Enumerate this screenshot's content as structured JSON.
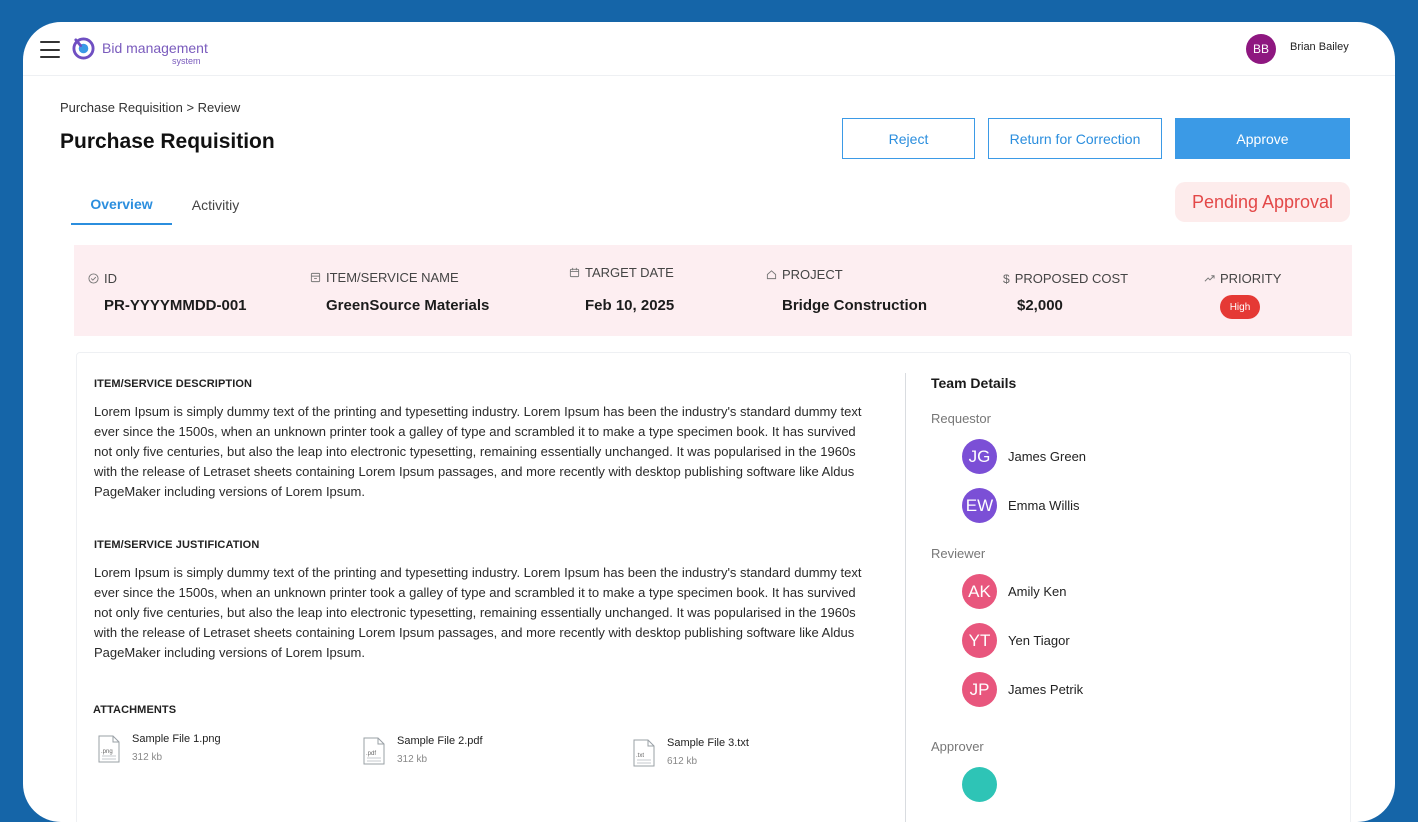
{
  "app": {
    "brand": "Bid management",
    "brand_sub": "system"
  },
  "user": {
    "initials": "BB",
    "name": "Brian Bailey"
  },
  "header": {
    "breadcrumb": "Purchase Requisition > Review",
    "title": "Purchase Requisition",
    "actions": {
      "reject": "Reject",
      "return": "Return for Correction",
      "approve": "Approve"
    }
  },
  "tabs": {
    "overview": "Overview",
    "activity": "Activitiy"
  },
  "status": "Pending Approval",
  "summary": {
    "id": {
      "label": "ID",
      "value": "PR-YYYYMMDD-001",
      "icon": "check-circle-icon"
    },
    "item": {
      "label": "ITEM/SERVICE NAME",
      "value": "GreenSource Materials",
      "icon": "box-icon"
    },
    "target_date": {
      "label": "TARGET DATE",
      "value": "Feb 10, 2025",
      "icon": "calendar-icon"
    },
    "project": {
      "label": "PROJECT",
      "value": "Bridge Construction",
      "icon": "home-icon"
    },
    "cost": {
      "label": "PROPOSED COST",
      "value": "$2,000",
      "icon": "dollar-icon"
    },
    "priority": {
      "label": "PRIORITY",
      "value": "High",
      "icon": "trend-icon"
    }
  },
  "description": {
    "heading": "ITEM/SERVICE DESCRIPTION",
    "text": "Lorem Ipsum is simply dummy text of the printing and typesetting industry. Lorem Ipsum has been the industry's standard dummy text ever since the 1500s, when an unknown printer took a galley of type and scrambled it to make a type specimen book. It has survived not only five centuries, but also the leap into electronic typesetting, remaining essentially unchanged. It was popularised in the 1960s with the release of Letraset sheets containing Lorem Ipsum passages, and more recently with desktop publishing software like Aldus PageMaker including versions of Lorem Ipsum."
  },
  "justification": {
    "heading": "ITEM/SERVICE JUSTIFICATION",
    "text": "Lorem Ipsum is simply dummy text of the printing and typesetting industry. Lorem Ipsum has been the industry's standard dummy text ever since the 1500s, when an unknown printer took a galley of type and scrambled it to make a type specimen book. It has survived not only five centuries, but also the leap into electronic typesetting, remaining essentially unchanged. It was popularised in the 1960s with the release of Letraset sheets containing Lorem Ipsum passages, and more recently with desktop publishing software like Aldus PageMaker including versions of Lorem Ipsum."
  },
  "attachments": {
    "heading": "ATTACHMENTS",
    "files": [
      {
        "ext": ".png",
        "name": "Sample File 1.png",
        "size": "312 kb"
      },
      {
        "ext": ".pdf",
        "name": "Sample File 2.pdf",
        "size": "312 kb"
      },
      {
        "ext": ".txt",
        "name": "Sample File 3.txt",
        "size": "612 kb"
      }
    ]
  },
  "team": {
    "heading": "Team Details",
    "requestor_label": "Requestor",
    "reviewer_label": "Reviewer",
    "approver_label": "Approver",
    "requestors": [
      {
        "initials": "JG",
        "name": "James Green",
        "color": "#7b4fd6"
      },
      {
        "initials": "EW",
        "name": "Emma Willis",
        "color": "#7b4fd6"
      }
    ],
    "reviewers": [
      {
        "initials": "AK",
        "name": "Amily Ken",
        "color": "#e8567d"
      },
      {
        "initials": "YT",
        "name": "Yen Tiagor",
        "color": "#e8567d"
      },
      {
        "initials": "JP",
        "name": "James Petrik",
        "color": "#e8567d"
      }
    ]
  },
  "colors": {
    "accent": "#3b9ae6",
    "frame": "#1565a8",
    "danger": "#e53935"
  }
}
